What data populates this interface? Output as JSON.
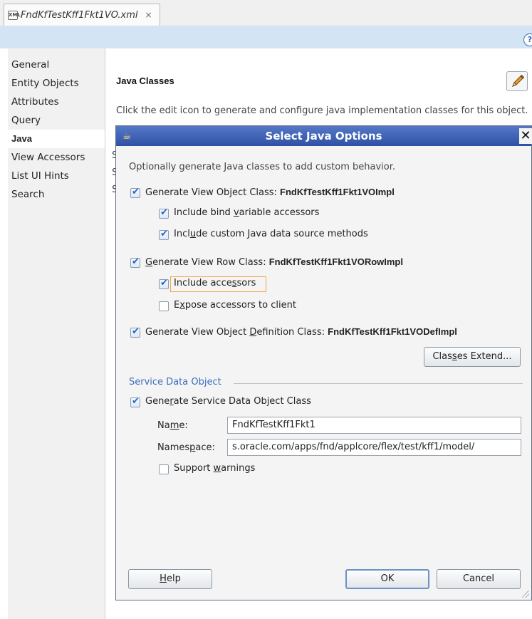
{
  "editor_tab": {
    "title": "FndKfTestKff1Fkt1VO.xml",
    "close": "×"
  },
  "toolbar": {
    "help_icon_glyph": "?"
  },
  "nav": {
    "items": [
      {
        "label": "General"
      },
      {
        "label": "Entity Objects"
      },
      {
        "label": "Attributes"
      },
      {
        "label": "Query"
      },
      {
        "label": "Java"
      },
      {
        "label": "View Accessors"
      },
      {
        "label": "List UI Hints"
      },
      {
        "label": "Search"
      }
    ],
    "selected": "Java"
  },
  "main": {
    "section_title": "Java Classes",
    "description": "Click the edit icon to generate and configure java implementation classes for this object.",
    "truncated_letters": [
      "S",
      "S",
      "S"
    ]
  },
  "dialog": {
    "title": "Select Java Options",
    "close_glyph": "✕",
    "intro": "Optionally generate Java classes to add custom behavior.",
    "vo_class": {
      "pre": "Generate View Ob",
      "mnemonic": "j",
      "post": "ect Class: ",
      "class_name": "FndKfTestKff1Fkt1VOImpl",
      "checked": true
    },
    "bind_accessors": {
      "pre": "Include bind ",
      "mnemonic": "v",
      "post": "ariable accessors",
      "checked": true
    },
    "custom_ds": {
      "pre": "Incl",
      "mnemonic": "u",
      "post": "de custom Java data source methods",
      "checked": true
    },
    "row_class": {
      "pre": "",
      "mnemonic": "G",
      "post": "enerate View Row Class: ",
      "class_name": "FndKfTestKff1Fkt1VORowImpl",
      "checked": true
    },
    "include_accessors": {
      "pre": "Include acce",
      "mnemonic": "s",
      "post": "sors",
      "checked": true
    },
    "expose_accessors": {
      "pre": "E",
      "mnemonic": "x",
      "post": "pose accessors to client",
      "checked": false
    },
    "def_class": {
      "pre": "Generate View Object ",
      "mnemonic": "D",
      "post": "efinition Class: ",
      "class_name": "FndKfTestKff1Fkt1VODefImpl",
      "checked": true
    },
    "classes_extend": {
      "pre": "Clas",
      "mnemonic": "s",
      "post": "es Extend..."
    },
    "sdo": {
      "heading": "Service Data Object",
      "generate": {
        "pre": "Gene",
        "mnemonic": "r",
        "post": "ate Service Data Object Class",
        "checked": true
      },
      "name_label": {
        "pre": "Na",
        "mnemonic": "m",
        "post": "e:"
      },
      "name_value": "FndKfTestKff1Fkt1",
      "namespace_label": {
        "pre": "Names",
        "mnemonic": "p",
        "post": "ace:"
      },
      "namespace_value": "s.oracle.com/apps/fnd/applcore/flex/test/kff1/model/",
      "warnings": {
        "pre": "Support ",
        "mnemonic": "w",
        "post": "arnings",
        "checked": false
      }
    },
    "buttons": {
      "help": {
        "pre": "",
        "mnemonic": "H",
        "post": "elp"
      },
      "ok": "OK",
      "cancel": "Cancel"
    }
  }
}
